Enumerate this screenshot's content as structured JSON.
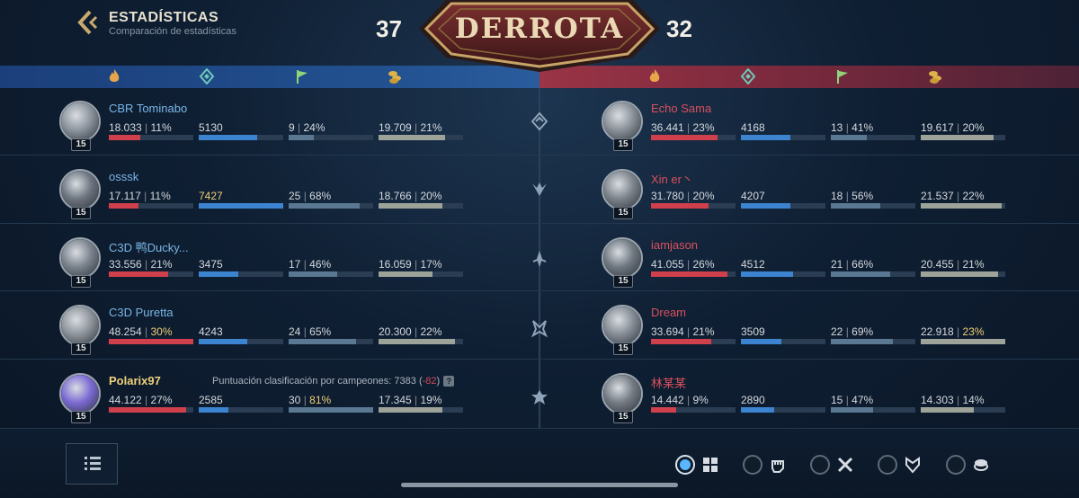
{
  "header": {
    "title": "ESTADÍSTICAS",
    "subtitle": "Comparación de estadísticas",
    "result": "DERROTA",
    "score_left": "37",
    "score_right": "32"
  },
  "stat_icons": [
    "damage-flame-icon",
    "vision-shield-icon",
    "objective-flag-icon",
    "gold-coins-icon"
  ],
  "blue_team": [
    {
      "name": "CBR Tominabo",
      "level": "15",
      "damage": "18.033",
      "damage_pct": "11%",
      "damage_fill": 0.37,
      "vision": "5130",
      "vision_fill": 0.69,
      "obj": "9",
      "obj_pct": "24%",
      "obj_fill": 0.3,
      "gold": "19.709",
      "gold_pct": "21%",
      "gold_fill": 0.79,
      "avatar_color": "#8b939c"
    },
    {
      "name": "osssk",
      "level": "15",
      "damage": "17.117",
      "damage_pct": "11%",
      "damage_fill": 0.35,
      "vision": "7427",
      "vision_fill": 1.0,
      "obj": "25",
      "obj_pct": "68%",
      "obj_fill": 0.84,
      "gold": "18.766",
      "gold_pct": "20%",
      "gold_fill": 0.75,
      "avatar_color": "#6d7580"
    },
    {
      "name": "C3D 鸭Ducky...",
      "level": "15",
      "damage": "33.556",
      "damage_pct": "21%",
      "damage_fill": 0.7,
      "vision": "3475",
      "vision_fill": 0.47,
      "obj": "17",
      "obj_pct": "46%",
      "obj_fill": 0.57,
      "gold": "16.059",
      "gold_pct": "17%",
      "gold_fill": 0.64,
      "avatar_color": "#7a828c"
    },
    {
      "name": "C3D Puretta",
      "level": "15",
      "damage": "48.254",
      "damage_pct": "30%",
      "damage_fill": 1.0,
      "vision": "4243",
      "vision_fill": 0.57,
      "obj": "24",
      "obj_pct": "65%",
      "obj_fill": 0.8,
      "gold": "20.300",
      "gold_pct": "22%",
      "gold_fill": 0.9,
      "avatar_color": "#8e949b"
    },
    {
      "name": "Polarix97",
      "level": "15",
      "damage": "44.122",
      "damage_pct": "27%",
      "damage_fill": 0.92,
      "vision": "2585",
      "vision_fill": 0.35,
      "obj": "30",
      "obj_pct": "81%",
      "obj_fill": 1.0,
      "gold": "17.345",
      "gold_pct": "19%",
      "gold_fill": 0.76,
      "avatar_color": "#7b6ad3"
    }
  ],
  "red_team": [
    {
      "name": "Echo Sama",
      "level": "15",
      "damage": "36.441",
      "damage_pct": "23%",
      "damage_fill": 0.79,
      "vision": "4168",
      "vision_fill": 0.58,
      "obj": "13",
      "obj_pct": "41%",
      "obj_fill": 0.43,
      "gold": "19.617",
      "gold_pct": "20%",
      "gold_fill": 0.86,
      "avatar_color": "#8a9098"
    },
    {
      "name": "Xin er丶",
      "level": "15",
      "damage": "31.780",
      "damage_pct": "20%",
      "damage_fill": 0.68,
      "vision": "4207",
      "vision_fill": 0.58,
      "obj": "18",
      "obj_pct": "56%",
      "obj_fill": 0.59,
      "gold": "21.537",
      "gold_pct": "22%",
      "gold_fill": 0.96,
      "avatar_color": "#7c838b"
    },
    {
      "name": "iamjason",
      "level": "15",
      "damage": "41.055",
      "damage_pct": "26%",
      "damage_fill": 0.9,
      "vision": "4512",
      "vision_fill": 0.62,
      "obj": "21",
      "obj_pct": "66%",
      "obj_fill": 0.7,
      "gold": "20.455",
      "gold_pct": "21%",
      "gold_fill": 0.91,
      "avatar_color": "#6f7780"
    },
    {
      "name": "Dream",
      "level": "15",
      "damage": "33.694",
      "damage_pct": "21%",
      "damage_fill": 0.71,
      "vision": "3509",
      "vision_fill": 0.48,
      "obj": "22",
      "obj_pct": "69%",
      "obj_fill": 0.73,
      "gold": "22.918",
      "gold_pct": "23%",
      "gold_fill": 1.0,
      "avatar_color": "#858c95"
    },
    {
      "name": "林某某",
      "level": "15",
      "damage": "14.442",
      "damage_pct": "9%",
      "damage_fill": 0.3,
      "vision": "2890",
      "vision_fill": 0.39,
      "obj": "15",
      "obj_pct": "47%",
      "obj_fill": 0.5,
      "gold": "14.303",
      "gold_pct": "14%",
      "gold_fill": 0.63,
      "avatar_color": "#737a82"
    }
  ],
  "rating": {
    "label": "Puntuación clasificación por campeones: ",
    "value": "7383",
    "delta": "-82"
  },
  "bottom_tabs": [
    "overview-tab",
    "damage-fist-tab",
    "tools-tab",
    "shield-tab",
    "gold-tab"
  ],
  "colors": {
    "blue_accent": "#79b6e6",
    "red_accent": "#d8505c",
    "gold_highlight": "#f0cf77"
  }
}
